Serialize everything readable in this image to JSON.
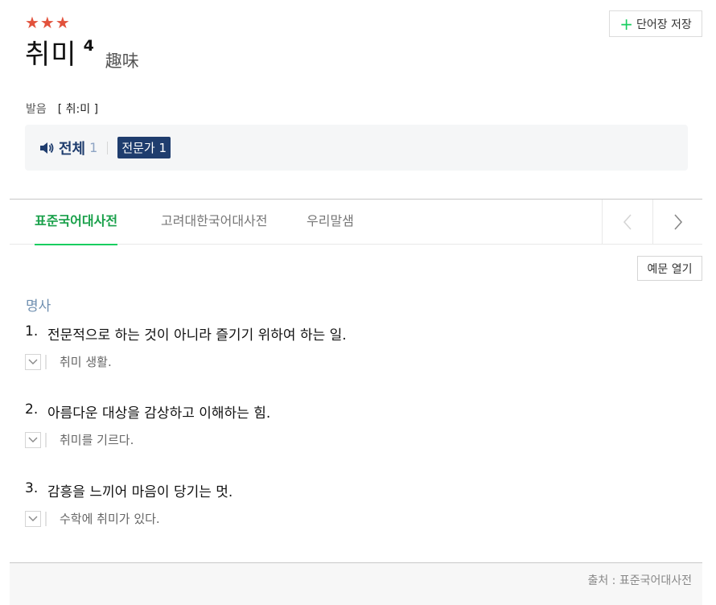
{
  "entry": {
    "stars": "★★★",
    "headword": "취미",
    "homonym_number": "4",
    "hanja": "趣味",
    "save_label": "단어장 저장",
    "pronunciation_label": "발음",
    "pronunciation_value": "[ 취:미 ]"
  },
  "audio": {
    "all_label": "전체",
    "all_count": "1",
    "expert_label": "전문가 1"
  },
  "tabs": [
    "표준국어대사전",
    "고려대한국어대사전",
    "우리말샘"
  ],
  "example_toggle_label": "예문 열기",
  "part_of_speech": "명사",
  "senses": [
    {
      "num": "1.",
      "definition": "전문적으로 하는 것이 아니라 즐기기 위하여 하는 일.",
      "example": "취미 생활."
    },
    {
      "num": "2.",
      "definition": "아름다운 대상을 감상하고 이해하는 힘.",
      "example": "취미를 기르다."
    },
    {
      "num": "3.",
      "definition": "감흥을 느끼어 마음이 당기는 멋.",
      "example": "수학에 취미가 있다."
    }
  ],
  "footer": {
    "source": "출처 : 표준국어대사전"
  },
  "colors": {
    "accent_green": "#19ce60",
    "star_red": "#e2523c",
    "navy": "#1f3d6e"
  }
}
